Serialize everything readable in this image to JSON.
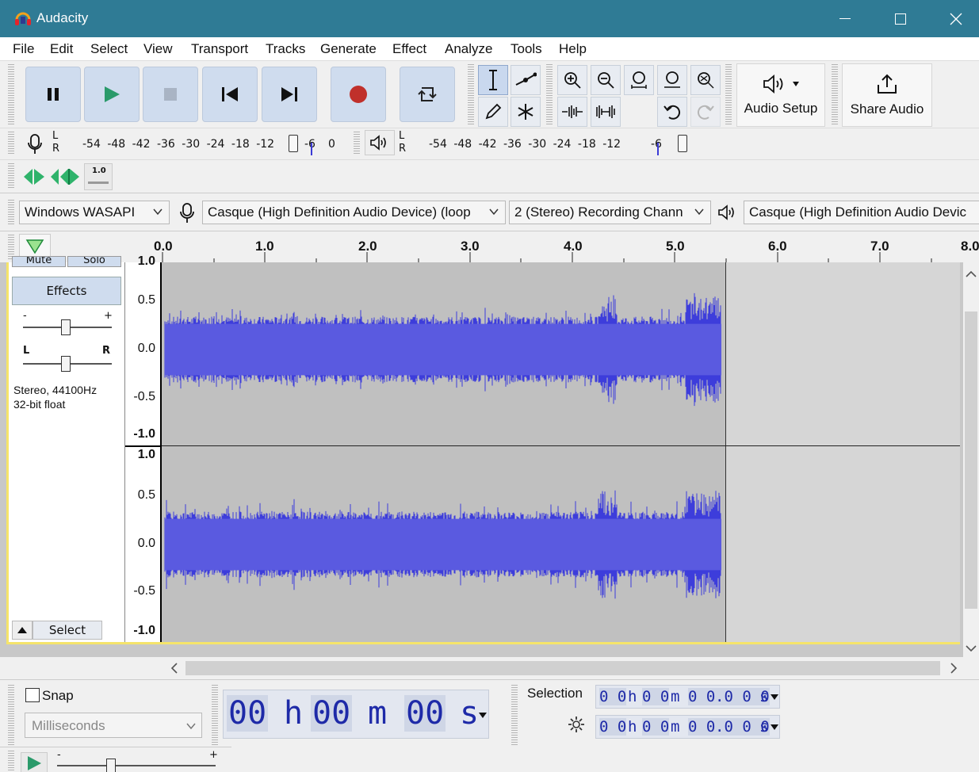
{
  "window": {
    "title": "Audacity"
  },
  "menu": [
    "File",
    "Edit",
    "Select",
    "View",
    "Transport",
    "Tracks",
    "Generate",
    "Effect",
    "Analyze",
    "Tools",
    "Help"
  ],
  "toolbar": {
    "audio_setup_label": "Audio Setup",
    "share_audio_label": "Share Audio"
  },
  "meters": {
    "record_scale": "-54 -48 -42 -36 -30 -24 -18 -12",
    "record_scale_end": "-6",
    "record_scale_zero": "0",
    "play_scale": "-54 -48 -42 -36 -30 -24 -18 -12",
    "play_scale_end": "-6",
    "channel_left": "L",
    "channel_right": "R"
  },
  "play_at_speed": {
    "speed_label": "1.0"
  },
  "devices": {
    "host": "Windows WASAPI",
    "recording_device": "Casque (High Definition Audio Device) (loop",
    "recording_channels": "2 (Stereo) Recording Chann",
    "playback_device": "Casque (High Definition Audio Devic"
  },
  "ruler": {
    "ticks": [
      "0.0",
      "1.0",
      "2.0",
      "3.0",
      "4.0",
      "5.0",
      "6.0",
      "7.0",
      "8.0"
    ]
  },
  "track": {
    "mute_label": "Mute",
    "solo_label": "Solo",
    "effects_label": "Effects",
    "gain_minus": "-",
    "gain_plus": "+",
    "pan_left": "L",
    "pan_right": "R",
    "info_line1": "Stereo, 44100Hz",
    "info_line2": "32-bit float",
    "select_label": "Select",
    "scale_labels": [
      "1.0",
      "0.5",
      "0.0",
      "-0.5",
      "-1.0"
    ],
    "wave_color": "#3d3ddb",
    "clip_color": "#c0c0c0"
  },
  "snap": {
    "snap_label": "Snap",
    "unit": "Milliseconds"
  },
  "time_display": {
    "hours": "00",
    "h": "h",
    "minutes": "00",
    "m": "m",
    "seconds": "00",
    "s": "s"
  },
  "selection": {
    "label": "Selection",
    "start": {
      "h1": "0 0",
      "h": "h",
      "m1": "0 0",
      "m": "m",
      "s1": "0 0",
      "ms": ".0 0 0",
      "s": "s"
    },
    "end": {
      "h1": "0 0",
      "h": "h",
      "m1": "0 0",
      "m": "m",
      "s1": "0 0",
      "ms": ".0 0 0",
      "s": "s"
    }
  },
  "playback_speed": {
    "minus": "-",
    "plus": "+"
  }
}
